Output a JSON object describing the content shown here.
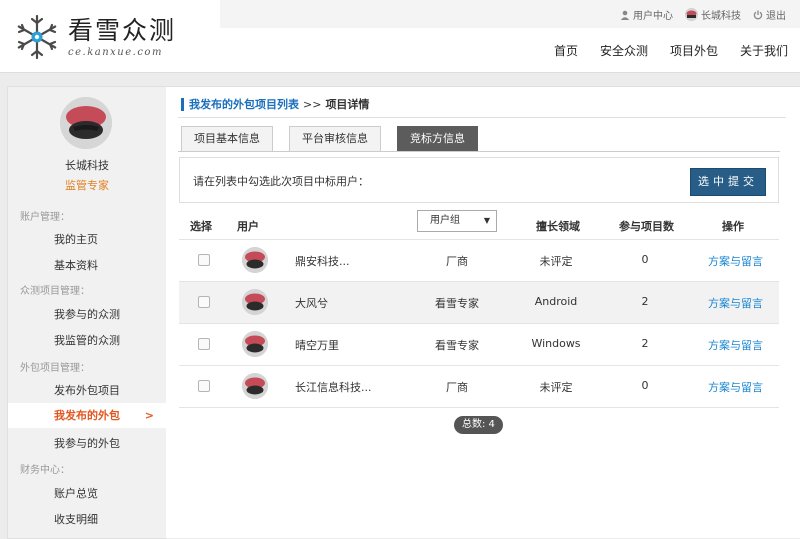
{
  "brand": {
    "name_cn": "看雪众测",
    "name_en": "ce.kanxue.com"
  },
  "top_links": {
    "user_center": "用户中心",
    "company": "长城科技",
    "logout": "退出"
  },
  "nav": [
    "首页",
    "安全众测",
    "项目外包",
    "关于我们"
  ],
  "profile": {
    "name": "长城科技",
    "role": "监管专家"
  },
  "sidebar": {
    "groups": [
      "账户管理：",
      "众测项目管理：",
      "外包项目管理：",
      "财务中心："
    ],
    "items": [
      "我的主页",
      "基本资料",
      "我参与的众测",
      "我监管的众测",
      "发布外包项目",
      "我发布的外包",
      "我参与的外包",
      "账户总览",
      "收支明细"
    ],
    "active_arrow": ">"
  },
  "breadcrumb": {
    "link": "我发布的外包项目列表",
    "sep": ">>",
    "current": "项目详情"
  },
  "tabs": [
    "项目基本信息",
    "平台审核信息",
    "竞标方信息"
  ],
  "selection": {
    "prompt": "请在列表中勾选此次项目中标用户：",
    "button": "选中提交"
  },
  "table": {
    "headers": {
      "select": "选择",
      "user": "用户",
      "group": "用户组",
      "field": "擅长领域",
      "count": "参与项目数",
      "op": "操作"
    },
    "rows": [
      {
        "name": "鼎安科技...",
        "group": "厂商",
        "field": "未评定",
        "count": "0",
        "action": "方案与留言"
      },
      {
        "name": "大风兮",
        "group": "看雪专家",
        "field": "Android",
        "count": "2",
        "action": "方案与留言"
      },
      {
        "name": "晴空万里",
        "group": "看雪专家",
        "field": "Windows",
        "count": "2",
        "action": "方案与留言"
      },
      {
        "name": "长江信息科技...",
        "group": "厂商",
        "field": "未评定",
        "count": "0",
        "action": "方案与留言"
      }
    ]
  },
  "total": "总数: 4",
  "colors": {
    "accent": "#1a6fbd",
    "active": "#e2561f",
    "role": "#e2801f",
    "button": "#275d87",
    "avatar_red": "#c44b57"
  }
}
